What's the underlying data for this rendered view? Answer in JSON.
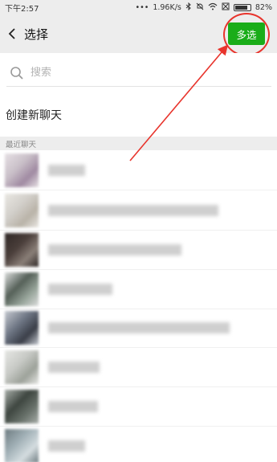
{
  "status_bar": {
    "time": "下午2:57",
    "dots": "•••",
    "speed": "1.96K/s",
    "battery_percent": 82,
    "battery_label": "82%"
  },
  "nav": {
    "back_icon": "chevron-left-icon",
    "title": "选择",
    "multi_select_label": "多选"
  },
  "search": {
    "placeholder": "搜索",
    "value": ""
  },
  "create_chat": {
    "label": "创建新聊天"
  },
  "recent": {
    "header": "最近聊天",
    "contacts": [
      {
        "name": "",
        "avatar_colors": [
          "#c9bfc8",
          "#a08aa2",
          "#e6e0e4"
        ]
      },
      {
        "name": "",
        "avatar_colors": [
          "#d2cfca",
          "#b9b3a8",
          "#e9e7e2"
        ]
      },
      {
        "name": "",
        "avatar_colors": [
          "#4a3e3a",
          "#8a7f78",
          "#2f2826"
        ]
      },
      {
        "name": "",
        "avatar_colors": [
          "#556058",
          "#98a59b",
          "#dcdedd"
        ]
      },
      {
        "name": "",
        "avatar_colors": [
          "#6e7684",
          "#3a3e48",
          "#c5c9d0"
        ]
      },
      {
        "name": "",
        "avatar_colors": [
          "#c8cac6",
          "#9da29a",
          "#e6e7e4"
        ]
      },
      {
        "name": "",
        "avatar_colors": [
          "#3e4640",
          "#6a736c",
          "#a8aea9"
        ]
      },
      {
        "name": "",
        "avatar_colors": [
          "#a3b2b8",
          "#d5dde0",
          "#6d7b80"
        ]
      }
    ]
  },
  "annotation_color": "#e8342c",
  "accent_color": "#1aad19"
}
